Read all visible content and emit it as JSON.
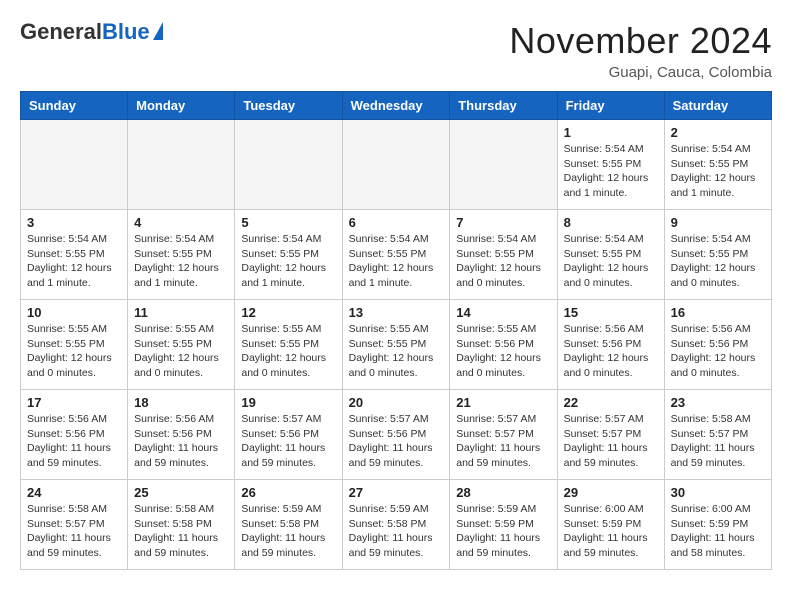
{
  "header": {
    "logo_general": "General",
    "logo_blue": "Blue",
    "month_title": "November 2024",
    "location": "Guapi, Cauca, Colombia"
  },
  "weekdays": [
    "Sunday",
    "Monday",
    "Tuesday",
    "Wednesday",
    "Thursday",
    "Friday",
    "Saturday"
  ],
  "weeks": [
    [
      {
        "day": "",
        "info": ""
      },
      {
        "day": "",
        "info": ""
      },
      {
        "day": "",
        "info": ""
      },
      {
        "day": "",
        "info": ""
      },
      {
        "day": "",
        "info": ""
      },
      {
        "day": "1",
        "info": "Sunrise: 5:54 AM\nSunset: 5:55 PM\nDaylight: 12 hours\nand 1 minute."
      },
      {
        "day": "2",
        "info": "Sunrise: 5:54 AM\nSunset: 5:55 PM\nDaylight: 12 hours\nand 1 minute."
      }
    ],
    [
      {
        "day": "3",
        "info": "Sunrise: 5:54 AM\nSunset: 5:55 PM\nDaylight: 12 hours\nand 1 minute."
      },
      {
        "day": "4",
        "info": "Sunrise: 5:54 AM\nSunset: 5:55 PM\nDaylight: 12 hours\nand 1 minute."
      },
      {
        "day": "5",
        "info": "Sunrise: 5:54 AM\nSunset: 5:55 PM\nDaylight: 12 hours\nand 1 minute."
      },
      {
        "day": "6",
        "info": "Sunrise: 5:54 AM\nSunset: 5:55 PM\nDaylight: 12 hours\nand 1 minute."
      },
      {
        "day": "7",
        "info": "Sunrise: 5:54 AM\nSunset: 5:55 PM\nDaylight: 12 hours\nand 0 minutes."
      },
      {
        "day": "8",
        "info": "Sunrise: 5:54 AM\nSunset: 5:55 PM\nDaylight: 12 hours\nand 0 minutes."
      },
      {
        "day": "9",
        "info": "Sunrise: 5:54 AM\nSunset: 5:55 PM\nDaylight: 12 hours\nand 0 minutes."
      }
    ],
    [
      {
        "day": "10",
        "info": "Sunrise: 5:55 AM\nSunset: 5:55 PM\nDaylight: 12 hours\nand 0 minutes."
      },
      {
        "day": "11",
        "info": "Sunrise: 5:55 AM\nSunset: 5:55 PM\nDaylight: 12 hours\nand 0 minutes."
      },
      {
        "day": "12",
        "info": "Sunrise: 5:55 AM\nSunset: 5:55 PM\nDaylight: 12 hours\nand 0 minutes."
      },
      {
        "day": "13",
        "info": "Sunrise: 5:55 AM\nSunset: 5:55 PM\nDaylight: 12 hours\nand 0 minutes."
      },
      {
        "day": "14",
        "info": "Sunrise: 5:55 AM\nSunset: 5:56 PM\nDaylight: 12 hours\nand 0 minutes."
      },
      {
        "day": "15",
        "info": "Sunrise: 5:56 AM\nSunset: 5:56 PM\nDaylight: 12 hours\nand 0 minutes."
      },
      {
        "day": "16",
        "info": "Sunrise: 5:56 AM\nSunset: 5:56 PM\nDaylight: 12 hours\nand 0 minutes."
      }
    ],
    [
      {
        "day": "17",
        "info": "Sunrise: 5:56 AM\nSunset: 5:56 PM\nDaylight: 11 hours\nand 59 minutes."
      },
      {
        "day": "18",
        "info": "Sunrise: 5:56 AM\nSunset: 5:56 PM\nDaylight: 11 hours\nand 59 minutes."
      },
      {
        "day": "19",
        "info": "Sunrise: 5:57 AM\nSunset: 5:56 PM\nDaylight: 11 hours\nand 59 minutes."
      },
      {
        "day": "20",
        "info": "Sunrise: 5:57 AM\nSunset: 5:56 PM\nDaylight: 11 hours\nand 59 minutes."
      },
      {
        "day": "21",
        "info": "Sunrise: 5:57 AM\nSunset: 5:57 PM\nDaylight: 11 hours\nand 59 minutes."
      },
      {
        "day": "22",
        "info": "Sunrise: 5:57 AM\nSunset: 5:57 PM\nDaylight: 11 hours\nand 59 minutes."
      },
      {
        "day": "23",
        "info": "Sunrise: 5:58 AM\nSunset: 5:57 PM\nDaylight: 11 hours\nand 59 minutes."
      }
    ],
    [
      {
        "day": "24",
        "info": "Sunrise: 5:58 AM\nSunset: 5:57 PM\nDaylight: 11 hours\nand 59 minutes."
      },
      {
        "day": "25",
        "info": "Sunrise: 5:58 AM\nSunset: 5:58 PM\nDaylight: 11 hours\nand 59 minutes."
      },
      {
        "day": "26",
        "info": "Sunrise: 5:59 AM\nSunset: 5:58 PM\nDaylight: 11 hours\nand 59 minutes."
      },
      {
        "day": "27",
        "info": "Sunrise: 5:59 AM\nSunset: 5:58 PM\nDaylight: 11 hours\nand 59 minutes."
      },
      {
        "day": "28",
        "info": "Sunrise: 5:59 AM\nSunset: 5:59 PM\nDaylight: 11 hours\nand 59 minutes."
      },
      {
        "day": "29",
        "info": "Sunrise: 6:00 AM\nSunset: 5:59 PM\nDaylight: 11 hours\nand 59 minutes."
      },
      {
        "day": "30",
        "info": "Sunrise: 6:00 AM\nSunset: 5:59 PM\nDaylight: 11 hours\nand 58 minutes."
      }
    ]
  ]
}
